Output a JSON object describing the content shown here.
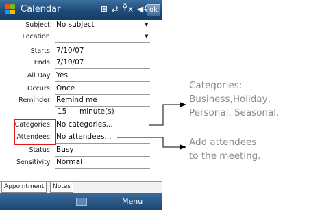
{
  "titlebar": {
    "title": "Calendar",
    "status_icons": "⊞ ⇄ Ÿx ◀€",
    "ok_label": "ok",
    "bg_color": "#1d4a78"
  },
  "form": {
    "subject_label": "Subject:",
    "subject_value": "No subject",
    "location_label": "Location:",
    "location_value": "",
    "starts_label": "Starts:",
    "starts_value": "7/10/07",
    "ends_label": "Ends:",
    "ends_value": "7/10/07",
    "allday_label": "All Day:",
    "allday_value": "Yes",
    "occurs_label": "Occurs:",
    "occurs_value": "Once",
    "reminder_label": "Reminder:",
    "reminder_value": "Remind me",
    "reminder_amount": "15",
    "reminder_unit": "minute(s)",
    "categories_label": "Categories:",
    "categories_value": "No categories...",
    "attendees_label": "Attendees:",
    "attendees_value": "No attendees...",
    "status_label": "Status:",
    "status_value": "Busy",
    "sensitivity_label": "Sensitivity:",
    "sensitivity_value": "Normal"
  },
  "tabs": [
    {
      "label": "Appointment"
    },
    {
      "label": "Notes"
    }
  ],
  "menubar": {
    "menu_label": "Menu"
  },
  "callouts": {
    "categories_lines": [
      "Categories:",
      "Business,Holiday,",
      "Personal, Seasonal."
    ],
    "attendees_lines": [
      "Add attendees",
      "to the meeting."
    ]
  },
  "colors": {
    "highlight": "#e0181c",
    "callout_text": "#8a8a8a"
  }
}
